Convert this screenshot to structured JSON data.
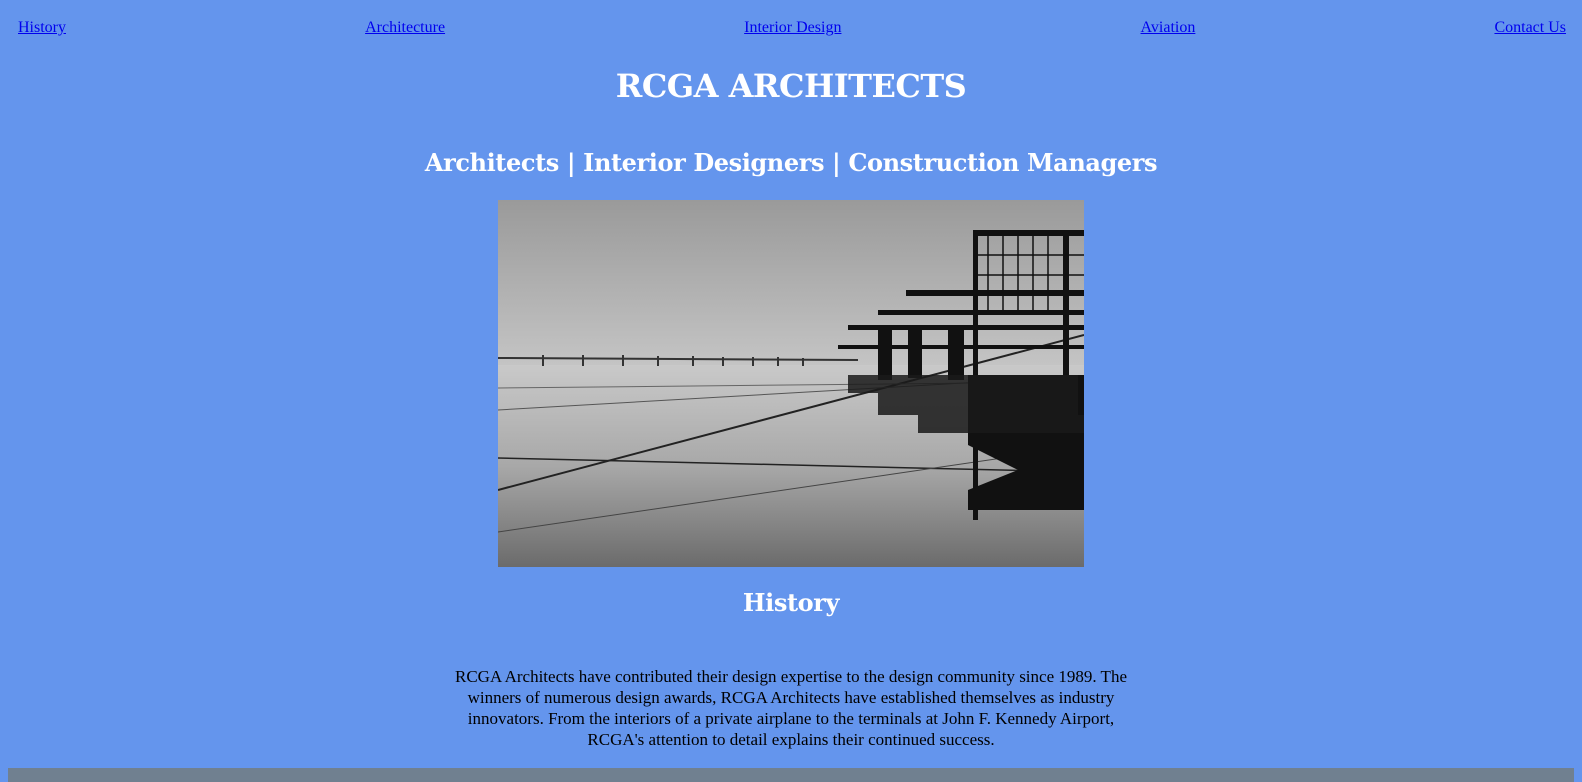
{
  "nav": {
    "items": [
      {
        "label": "History"
      },
      {
        "label": "Architecture"
      },
      {
        "label": "Interior Design"
      },
      {
        "label": "Aviation"
      },
      {
        "label": "Contact Us"
      }
    ]
  },
  "header": {
    "title": "RCGA ARCHITECTS",
    "subtitle": "Architects | Interior Designers | Construction Managers"
  },
  "history": {
    "heading": "History",
    "body": "RCGA Architects have contributed their design expertise to the design community since 1989. The winners of numerous design awards, RCGA Architects have established themselves as industry innovators. From the interiors of a private airplane to the terminals at John F. Kennedy Airport, RCGA's attention to detail explains their continued success."
  },
  "colors": {
    "background": "#6495ED",
    "link": "#0000EE",
    "heading": "#FFFFFF",
    "footer": "#708090"
  }
}
